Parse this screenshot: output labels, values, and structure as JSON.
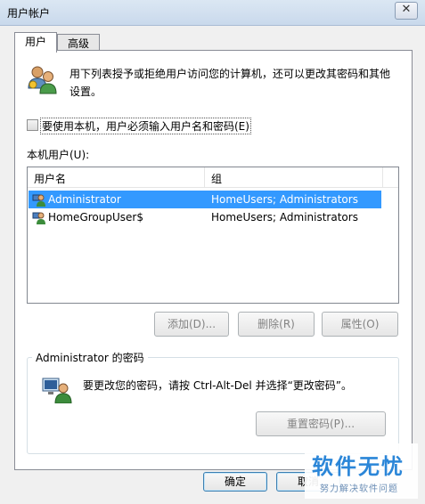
{
  "window": {
    "title": "用户帐户",
    "close_glyph": "✕"
  },
  "tabs": [
    {
      "label": "用户"
    },
    {
      "label": "高级"
    }
  ],
  "intro": {
    "text": "用下列表授予或拒绝用户访问您的计算机，还可以更改其密码和其他设置。"
  },
  "require_login": {
    "label": "要使用本机，用户必须输入用户名和密码(E)",
    "checked": false
  },
  "local_users": {
    "label": "本机用户(U):",
    "columns": [
      "用户名",
      "组"
    ],
    "rows": [
      {
        "name": "Administrator",
        "group": "HomeUsers; Administrators",
        "selected": true
      },
      {
        "name": "HomeGroupUser$",
        "group": "HomeUsers; Administrators",
        "selected": false
      }
    ]
  },
  "buttons": {
    "add": "添加(D)...",
    "remove": "删除(R)",
    "properties": "属性(O)"
  },
  "password": {
    "title": "Administrator 的密码",
    "text": "要更改您的密码，请按 Ctrl-Alt-Del 并选择“更改密码”。",
    "reset_button": "重置密码(P)..."
  },
  "footer": {
    "ok": "确定",
    "cancel": "取消"
  },
  "watermark": {
    "main": "软件无忧",
    "sub": "努力解决软件问题"
  },
  "colors": {
    "selection": "#3399ff",
    "titlebar": "#c9d9ec",
    "accent": "#2b86d8"
  }
}
